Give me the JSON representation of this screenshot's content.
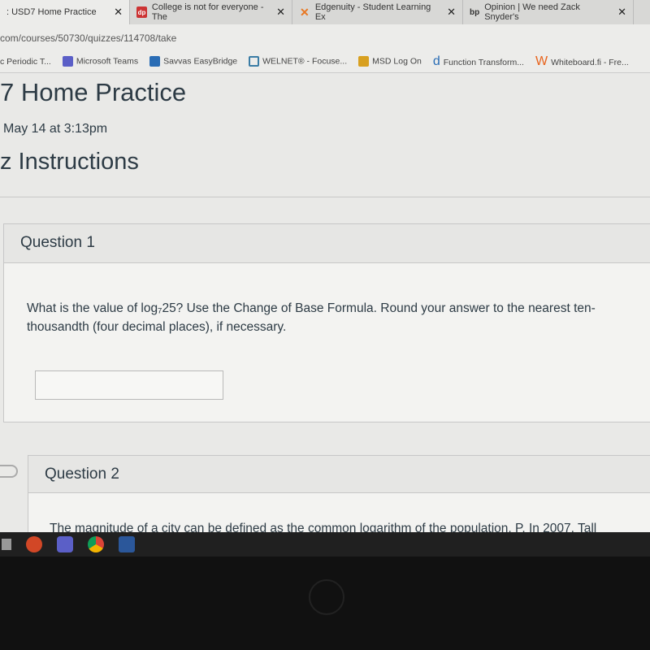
{
  "browser": {
    "tabs": [
      {
        "label": ": USD7 Home Practice",
        "active": true
      },
      {
        "label": "College is not for everyone - The",
        "icon": "dp"
      },
      {
        "label": "Edgenuity - Student Learning Ex"
      },
      {
        "label": "Opinion | We need Zack Snyder's",
        "icon": "bp"
      }
    ],
    "url": "com/courses/50730/quizzes/114708/take",
    "bookmarks": [
      "c Periodic T...",
      "Microsoft Teams",
      "Savvas EasyBridge",
      "WELNET® - Focuse...",
      "MSD Log On",
      "Function Transform...",
      "Whiteboard.fi - Fre..."
    ]
  },
  "page": {
    "title": "7 Home Practice",
    "due": "May 14 at 3:13pm",
    "instructions": "z Instructions",
    "questions": [
      {
        "header": "Question 1",
        "text": "What is the value of log₇25? Use the Change of Base Formula. Round your answer to the nearest ten-thousandth (four decimal places), if necessary.",
        "answer": ""
      },
      {
        "header": "Question 2",
        "text": "The magnitude of a city can be defined as the common logarithm of the population, P. In 2007, Tall"
      }
    ]
  }
}
